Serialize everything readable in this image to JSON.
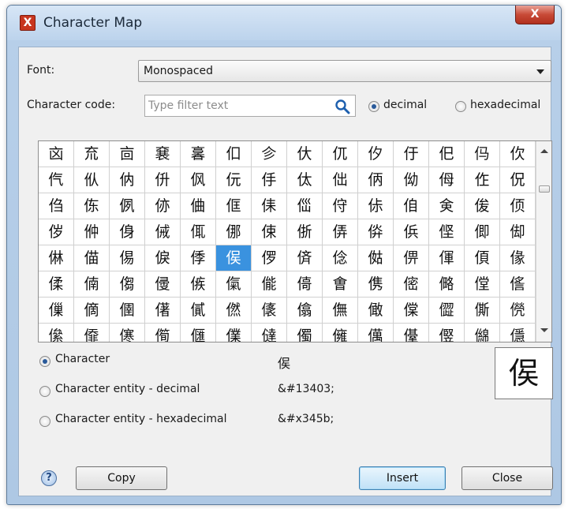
{
  "window": {
    "title": "Character Map",
    "app_icon_glyph": "X",
    "close_glyph": "X"
  },
  "font_row": {
    "label": "Font:",
    "selected": "Monospaced"
  },
  "code_row": {
    "label": "Character code:",
    "filter_placeholder": "Type filter text",
    "radio_decimal": "decimal",
    "radio_hex": "hexadecimal",
    "selected_radio": "decimal"
  },
  "grid": {
    "selected_row": 4,
    "selected_col": 5,
    "rows": [
      [
        "㐫",
        "㐬",
        "㐭",
        "㐮",
        "㐯",
        "㐰",
        "㐱",
        "㐲",
        "㐳",
        "㐴",
        "㐵",
        "㐶",
        "㐷",
        "㐸"
      ],
      [
        "㐹",
        "㐺",
        "㐻",
        "㐼",
        "㐽",
        "㐾",
        "㐿",
        "㑀",
        "㑁",
        "㑂",
        "㑃",
        "㑄",
        "㑅",
        "㑆"
      ],
      [
        "㑇",
        "㑈",
        "㑉",
        "㑊",
        "㑋",
        "㑌",
        "㑍",
        "㑎",
        "㑏",
        "㑐",
        "㑑",
        "㑒",
        "㑓",
        "㑔"
      ],
      [
        "㑕",
        "㑖",
        "㑗",
        "㑘",
        "㑙",
        "㑚",
        "㑛",
        "㑜",
        "㑝",
        "㑞",
        "㑟",
        "㑠",
        "㑡",
        "㑢"
      ],
      [
        "㑣",
        "㑤",
        "㑥",
        "㑦",
        "㑧",
        "㑨",
        "㑩",
        "㑪",
        "㑫",
        "㑬",
        "㑭",
        "㑮",
        "㑯",
        "㑰"
      ],
      [
        "㑱",
        "㑲",
        "㑳",
        "㑴",
        "㑵",
        "㑶",
        "㑷",
        "㑸",
        "㑹",
        "㑺",
        "㑻",
        "㑼",
        "㑽",
        "㑾"
      ],
      [
        "㑿",
        "㒀",
        "㒁",
        "㒂",
        "㒃",
        "㒄",
        "㒅",
        "㒆",
        "㒇",
        "㒈",
        "㒉",
        "㒊",
        "㒋",
        "㒌"
      ],
      [
        "㒍",
        "㒎",
        "㒏",
        "㒐",
        "㒑",
        "㒒",
        "㒓",
        "㒔",
        "㒕",
        "㒖",
        "㒗",
        "㒘",
        "㒙",
        "㒚"
      ]
    ]
  },
  "output": {
    "selected_option": "Character",
    "options": [
      {
        "label": "Character",
        "value": "㑨"
      },
      {
        "label": "Character entity - decimal",
        "value": "&#13403;"
      },
      {
        "label": "Character entity - hexadecimal",
        "value": "&#x345b;"
      }
    ],
    "preview_char": "㑨"
  },
  "buttons": {
    "copy": "Copy",
    "insert": "Insert",
    "close": "Close",
    "help_glyph": "?"
  },
  "colors": {
    "selection": "#3a92df",
    "titlebar": "#bcd3ec",
    "close_button": "#c84a37"
  }
}
